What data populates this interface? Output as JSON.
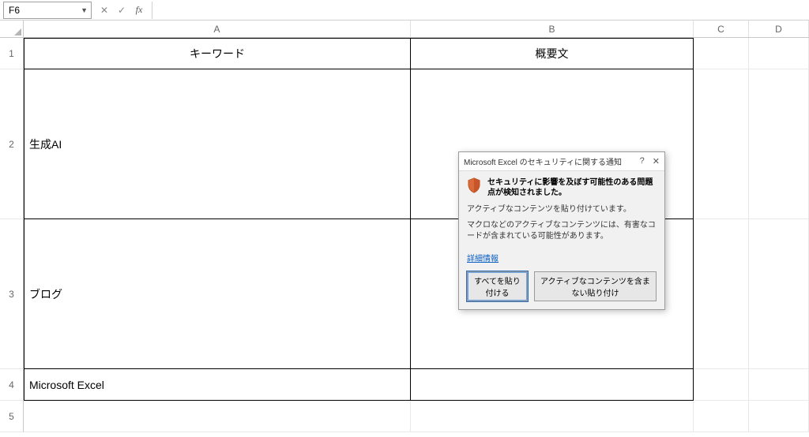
{
  "name_box": {
    "value": "F6"
  },
  "formula_bar": {
    "value": ""
  },
  "columns": {
    "A": "A",
    "B": "B",
    "C": "C",
    "D": "D"
  },
  "rows": {
    "r1": "1",
    "r2": "2",
    "r3": "3",
    "r4": "4",
    "r5": "5"
  },
  "headers": {
    "A": "キーワード",
    "B": "概要文"
  },
  "cells": {
    "A2": "生成AI",
    "B2": "",
    "A3": "ブログ",
    "B3": "",
    "A4": "Microsoft Excel",
    "B4": ""
  },
  "dialog": {
    "title": "Microsoft Excel のセキュリティに関する通知",
    "help": "?",
    "close": "✕",
    "warning": "セキュリティに影響を及ぼす可能性のある問題点が検知されました。",
    "p1": "アクティブなコンテンツを貼り付けています。",
    "p2": "マクロなどのアクティブなコンテンツには、有害なコードが含まれている可能性があります。",
    "link": "詳細情報",
    "btn_all": "すべてを貼り付ける",
    "btn_safe": "アクティブなコンテンツを含まない貼り付け"
  }
}
